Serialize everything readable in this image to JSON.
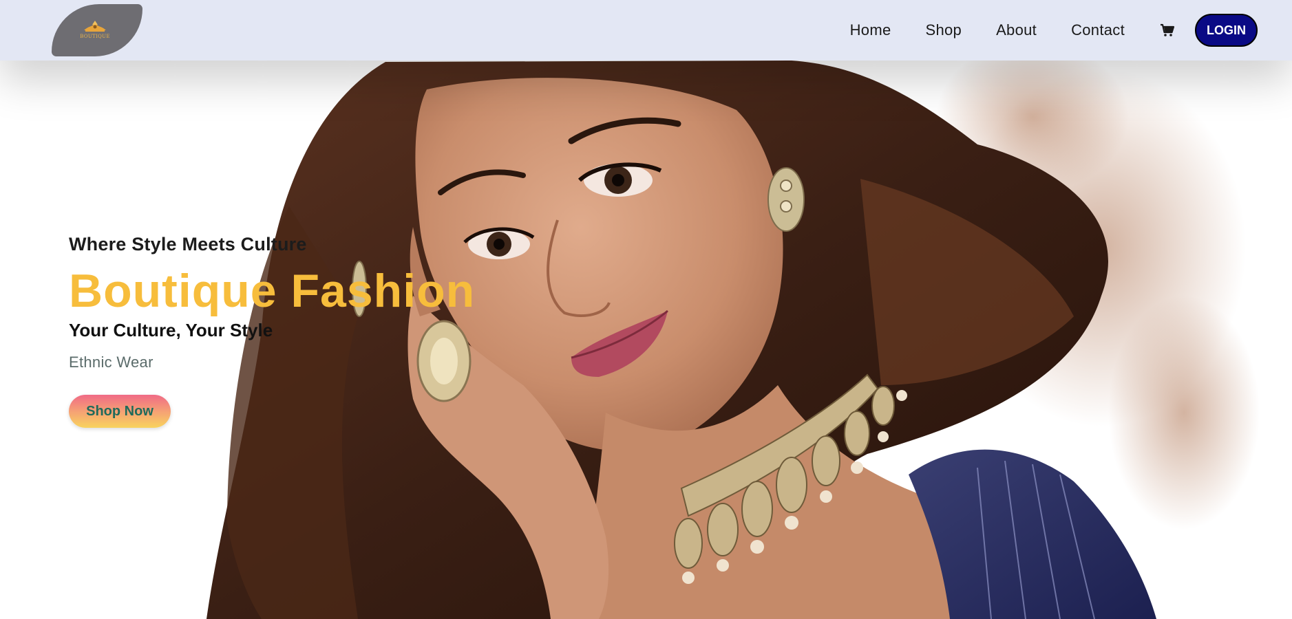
{
  "navbar": {
    "logo_text": "BOUTIQUE",
    "links": [
      "Home",
      "Shop",
      "About",
      "Contact"
    ],
    "cart_icon": "cart-icon",
    "login_label": "LOGIN"
  },
  "hero": {
    "tagline": "Where Style Meets Culture",
    "title": "Boutique Fashion",
    "subtitle": "Your Culture, Your Style",
    "category": "Ethnic Wear",
    "cta_label": "Shop Now"
  },
  "colors": {
    "navbar_bg": "#e3e7f4",
    "login_bg": "#0a0a85",
    "title_gold": "#f7bd3c",
    "cta_text": "#1f6b5a"
  }
}
